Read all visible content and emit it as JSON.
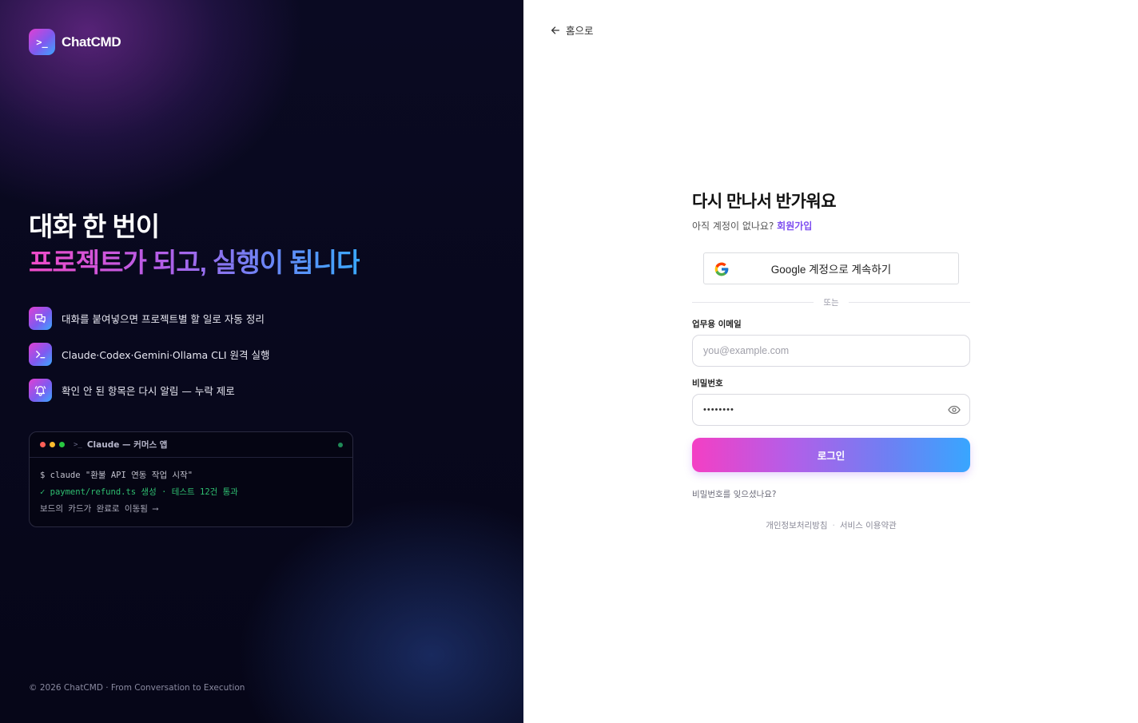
{
  "brand": {
    "name": "ChatCMD",
    "badge": ">_"
  },
  "hero": {
    "line1": "대화 한 번이",
    "line2": "프로젝트가 되고, 실행이 됩니다"
  },
  "features": [
    {
      "icon": "chat-bubbles-icon",
      "text": "대화를 붙여넣으면 프로젝트별 할 일로 자동 정리"
    },
    {
      "icon": "terminal-prompt-icon",
      "text": "Claude·Codex·Gemini·Ollama CLI 원격 실행"
    },
    {
      "icon": "bell-icon",
      "text": "확인 안 된 항목은 다시 알림 — 누락 제로"
    }
  ],
  "terminal": {
    "title": "Claude — 커머스 앱",
    "lines": [
      "$ claude \"환불 API 연동 작업 시작\"",
      "✓ payment/refund.ts 생성 · 테스트 12건 통과",
      "보드의 카드가 완료로 이동됨 ⟶"
    ]
  },
  "footer_left": "© 2026 ChatCMD · From Conversation to Execution",
  "back_link": "홈으로",
  "form": {
    "title": "다시 만나서 반가워요",
    "no_account": "아직 계정이 없나요?",
    "signup": "회원가입",
    "google_button": "Google 계정으로 계속하기",
    "divider": "또는",
    "email_label": "업무용 이메일",
    "email_placeholder": "you@example.com",
    "password_label": "비밀번호",
    "password_value": "••••••••",
    "login_button": "로그인",
    "forgot": "비밀번호를 잊으셨나요?",
    "privacy": "개인정보처리방침",
    "terms": "서비스 이용약관",
    "legal_separator": "·"
  },
  "colors": {
    "accent_pink": "#f43fc4",
    "accent_purple": "#7c4cf0",
    "accent_blue": "#38a6ff",
    "terminal_green": "#2fbf71",
    "dot_red": "#ff5f57",
    "dot_yellow": "#febc2e",
    "dot_green": "#28c840"
  }
}
